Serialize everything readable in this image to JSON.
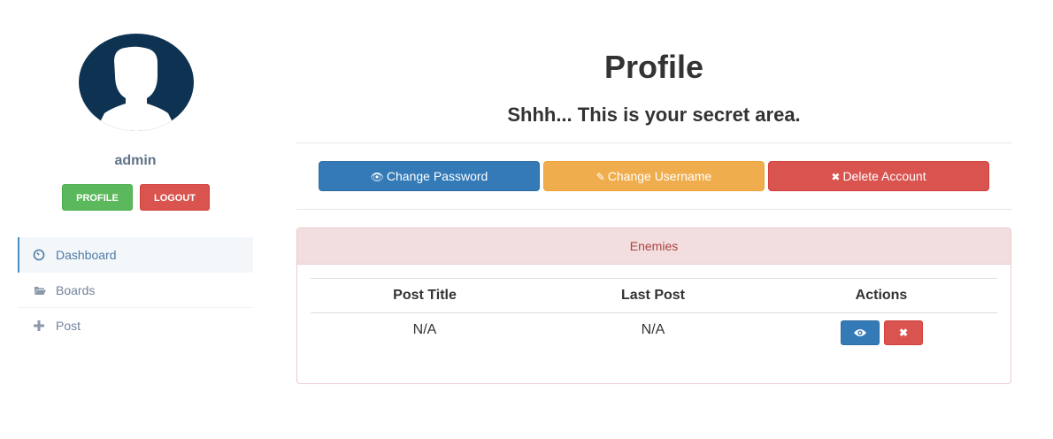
{
  "sidebar": {
    "username": "admin",
    "profile_button": "PROFILE",
    "logout_button": "LOGOUT",
    "nav": [
      {
        "label": "Dashboard",
        "icon": "dashboard-icon",
        "active": true
      },
      {
        "label": "Boards",
        "icon": "folder-open-icon",
        "active": false
      },
      {
        "label": "Post",
        "icon": "plus-icon",
        "active": false
      }
    ]
  },
  "main": {
    "title": "Profile",
    "subtitle": "Shhh... This is your secret area.",
    "actions": {
      "change_password": "Change Password",
      "change_username": "Change Username",
      "delete_account": "Delete Account"
    },
    "panel": {
      "heading": "Enemies",
      "columns": [
        "Post Title",
        "Last Post",
        "Actions"
      ],
      "rows": [
        {
          "post_title": "N/A",
          "last_post": "N/A"
        }
      ]
    }
  },
  "colors": {
    "avatar_bg": "#0e3352",
    "success": "#5cb85c",
    "danger": "#d9534f",
    "primary": "#337ab7",
    "warning": "#f0ad4e",
    "panel_danger_bg": "#f2dede",
    "panel_danger_text": "#a94442",
    "nav_active_border": "#4a90c8"
  }
}
